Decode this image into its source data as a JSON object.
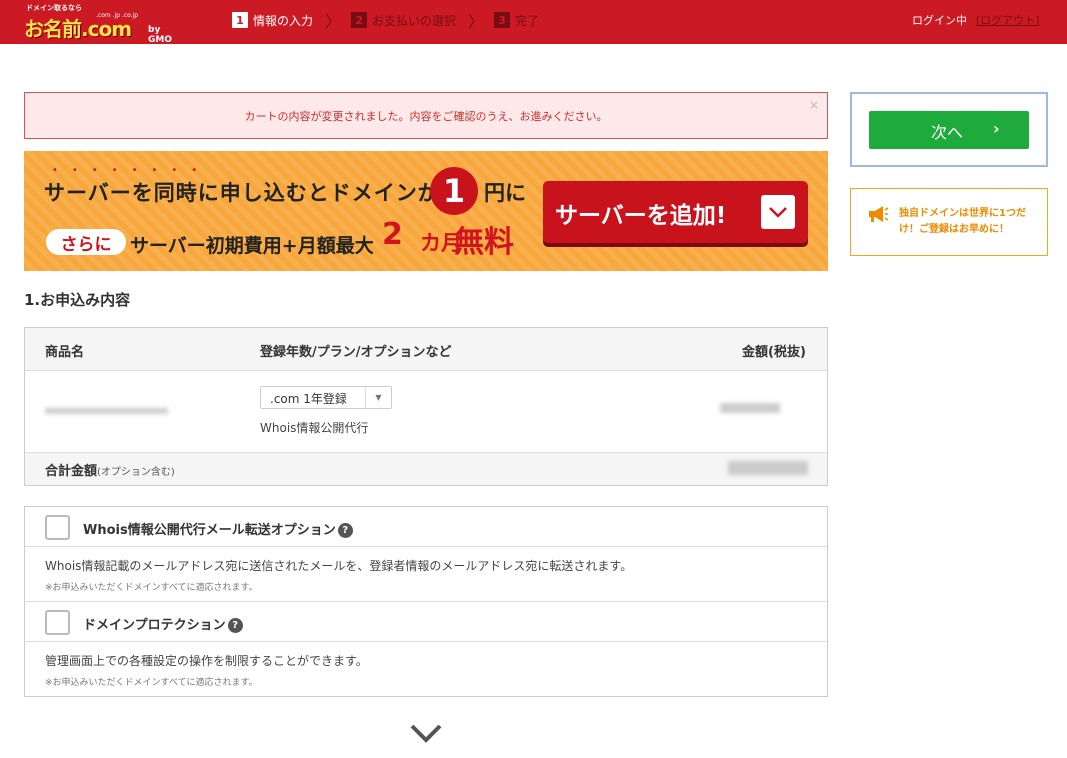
{
  "header": {
    "logo_tagline": "ドメイン取るなら",
    "logo_text": "お名前.com",
    "logo_tlds": ".com .jp .co.jp",
    "logo_brand": "by GMO",
    "steps": [
      {
        "num": "1",
        "label": "情報の入力",
        "active": true
      },
      {
        "num": "2",
        "label": "お支払いの選択",
        "active": false
      },
      {
        "num": "3",
        "label": "完了",
        "active": false
      }
    ],
    "login_status": "ログイン中",
    "logout_label": "[ログアウト]"
  },
  "alert": {
    "message": "カートの内容が変更されました。内容をご確認のうえ、お進みください。",
    "close_glyph": "×"
  },
  "banner": {
    "line1_before": "サーバーを同時に申し込むとドメインが",
    "price_number": "1",
    "line1_after": "円に",
    "sarani": "さらに",
    "line2": "サーバー初期費用+月額最大",
    "line2_num": "2",
    "line2_unit": "カ月",
    "line2_free": "無料",
    "button_label": "サーバーを追加!"
  },
  "section": {
    "title": "1.お申込み内容"
  },
  "order_table": {
    "headers": {
      "product": "商品名",
      "plan": "登録年数/プラン/オプションなど",
      "price": "金額(税抜)"
    },
    "plan_select_value": ".com 1年登録",
    "whois_proxy": "Whois情報公開代行",
    "total_label": "合計金額",
    "total_note": "(オプション含む)"
  },
  "options": [
    {
      "title": "Whois情報公開代行メール転送オプション",
      "description": "Whois情報記載のメールアドレス宛に送信されたメールを、登録者情報のメールアドレス宛に転送されます。",
      "note": "※お申込みいただくドメインすべてに適応されます。",
      "checked": false
    },
    {
      "title": "ドメインプロテクション",
      "description": "管理画面上での各種設定の操作を制限することができます。",
      "note": "※お申込みいただくドメインすべてに適応されます。",
      "checked": false
    }
  ],
  "sidebar": {
    "next_label": "次へ",
    "next_arrow": "›",
    "notice_text": "独自ドメインは世界に1つだけ！ご登録はお早めに！"
  },
  "colors": {
    "header_red": "#cc1a24",
    "next_green": "#1faa3c",
    "notice_orange": "#f08a00",
    "banner_orange": "#f9a63b"
  }
}
